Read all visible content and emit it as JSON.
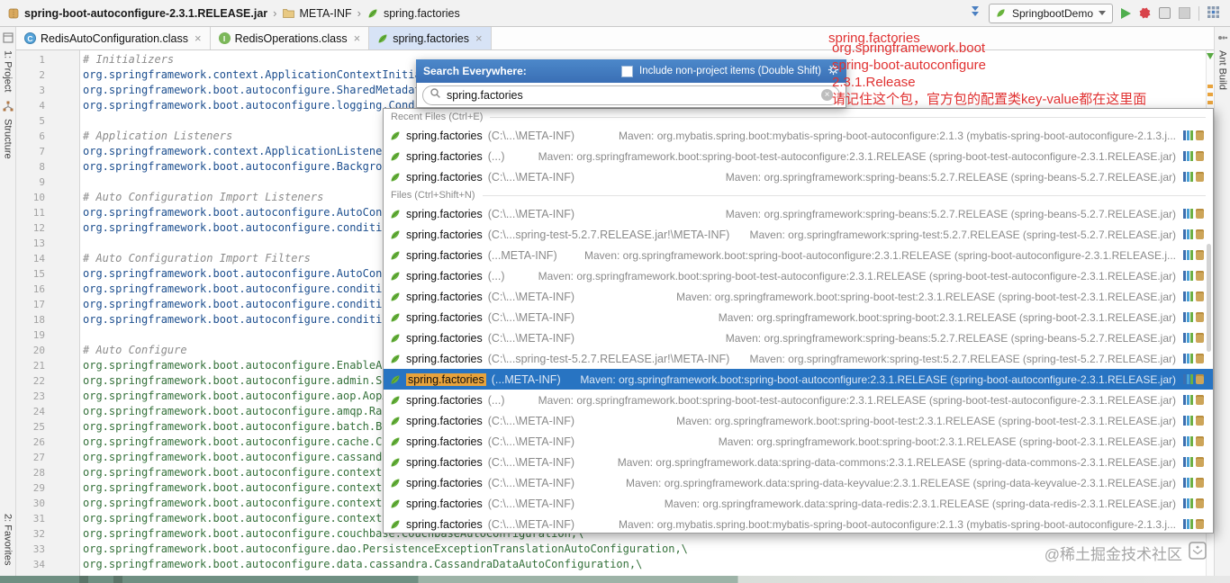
{
  "title_bar": {
    "breadcrumb": {
      "jar": "spring-boot-autoconfigure-2.3.1.RELEASE.jar",
      "dir": "META-INF",
      "file": "spring.factories"
    },
    "run_config": "SpringbootDemo"
  },
  "tabs": [
    {
      "label": "RedisAutoConfiguration.class"
    },
    {
      "label": "RedisOperations.class"
    },
    {
      "label": "spring.factories"
    }
  ],
  "tool_windows": {
    "project": "1: Project",
    "structure": "Structure",
    "favorites": "2: Favorites",
    "ant": "Ant Build"
  },
  "editor": {
    "lines": [
      {
        "n": 1,
        "cls": "comment",
        "text": "# Initializers"
      },
      {
        "n": 2,
        "cls": "ka",
        "text": "org.springframework.context.ApplicationContextInitializer=\\"
      },
      {
        "n": 3,
        "cls": "ka",
        "text": "org.springframework.boot.autoconfigure.SharedMetadataReaderFactoryContextInitializer,\\"
      },
      {
        "n": 4,
        "cls": "ka",
        "text": "org.springframework.boot.autoconfigure.logging.ConditionEvaluationReportLoggingListener"
      },
      {
        "n": 5,
        "cls": "ka",
        "text": ""
      },
      {
        "n": 6,
        "cls": "comment",
        "text": "# Application Listeners"
      },
      {
        "n": 7,
        "cls": "ka",
        "text": "org.springframework.context.ApplicationListener=\\"
      },
      {
        "n": 8,
        "cls": "ka",
        "text": "org.springframework.boot.autoconfigure.BackgroundPreinitializer"
      },
      {
        "n": 9,
        "cls": "ka",
        "text": ""
      },
      {
        "n": 10,
        "cls": "comment",
        "text": "# Auto Configuration Import Listeners"
      },
      {
        "n": 11,
        "cls": "ka",
        "text": "org.springframework.boot.autoconfigure.AutoConfigurationImportListener=\\"
      },
      {
        "n": 12,
        "cls": "ka",
        "text": "org.springframework.boot.autoconfigure.condition.ConditionEvaluationReportAutoConfigurationImportListener"
      },
      {
        "n": 13,
        "cls": "ka",
        "text": ""
      },
      {
        "n": 14,
        "cls": "comment",
        "text": "# Auto Configuration Import Filters"
      },
      {
        "n": 15,
        "cls": "ka",
        "text": "org.springframework.boot.autoconfigure.AutoConfigurationImportFilter=\\"
      },
      {
        "n": 16,
        "cls": "ka",
        "text": "org.springframework.boot.autoconfigure.condition.OnBeanCondition,\\"
      },
      {
        "n": 17,
        "cls": "ka",
        "text": "org.springframework.boot.autoconfigure.condition.OnClassCondition,\\"
      },
      {
        "n": 18,
        "cls": "ka",
        "text": "org.springframework.boot.autoconfigure.condition.OnWebApplicationCondition"
      },
      {
        "n": 19,
        "cls": "ka",
        "text": ""
      },
      {
        "n": 20,
        "cls": "comment",
        "text": "# Auto Configure"
      },
      {
        "n": 21,
        "cls": "kb",
        "text": "org.springframework.boot.autoconfigure.EnableAutoConfiguration=\\"
      },
      {
        "n": 22,
        "cls": "kb",
        "text": "org.springframework.boot.autoconfigure.admin.SpringApplicationAdminJmxAutoConfiguration,\\"
      },
      {
        "n": 23,
        "cls": "kb",
        "text": "org.springframework.boot.autoconfigure.aop.AopAutoConfiguration,\\"
      },
      {
        "n": 24,
        "cls": "kb",
        "text": "org.springframework.boot.autoconfigure.amqp.RabbitAutoConfiguration,\\"
      },
      {
        "n": 25,
        "cls": "kb",
        "text": "org.springframework.boot.autoconfigure.batch.BatchAutoConfiguration,\\"
      },
      {
        "n": 26,
        "cls": "kb",
        "text": "org.springframework.boot.autoconfigure.cache.CacheAutoConfiguration,\\"
      },
      {
        "n": 27,
        "cls": "kb",
        "text": "org.springframework.boot.autoconfigure.cassandra.CassandraAutoConfiguration,\\"
      },
      {
        "n": 28,
        "cls": "kb",
        "text": "org.springframework.boot.autoconfigure.context.ConfigurationPropertiesAutoConfiguration,\\"
      },
      {
        "n": 29,
        "cls": "kb",
        "text": "org.springframework.boot.autoconfigure.context.LifecycleAutoConfiguration,\\"
      },
      {
        "n": 30,
        "cls": "kb",
        "text": "org.springframework.boot.autoconfigure.context.MessageSourceAutoConfiguration,\\"
      },
      {
        "n": 31,
        "cls": "kb",
        "text": "org.springframework.boot.autoconfigure.context.PropertyPlaceholderAutoConfiguration,\\"
      },
      {
        "n": 32,
        "cls": "kb",
        "text": "org.springframework.boot.autoconfigure.couchbase.CouchbaseAutoConfiguration,\\"
      },
      {
        "n": 33,
        "cls": "kb",
        "text": "org.springframework.boot.autoconfigure.dao.PersistenceExceptionTranslationAutoConfiguration,\\"
      },
      {
        "n": 34,
        "cls": "kb",
        "text": "org.springframework.boot.autoconfigure.data.cassandra.CassandraDataAutoConfiguration,\\"
      }
    ]
  },
  "popup": {
    "title": "Search Everywhere:",
    "include_label": "Include non-project items (Double Shift)",
    "search_value": "spring.factories",
    "recent_header": "Recent Files (Ctrl+E)",
    "files_header": "Files (Ctrl+Shift+N)",
    "recent_rows": [
      {
        "name": "spring.factories",
        "path": "(C:\\...\\META-INF)",
        "detail": "Maven: org.mybatis.spring.boot:mybatis-spring-boot-autoconfigure:2.1.3 (mybatis-spring-boot-autoconfigure-2.1.3.j..."
      },
      {
        "name": "spring.factories",
        "path": "(...)",
        "detail": "Maven: org.springframework.boot:spring-boot-test-autoconfigure:2.3.1.RELEASE (spring-boot-test-autoconfigure-2.3.1.RELEASE.jar)"
      },
      {
        "name": "spring.factories",
        "path": "(C:\\...\\META-INF)",
        "detail": "Maven: org.springframework:spring-beans:5.2.7.RELEASE (spring-beans-5.2.7.RELEASE.jar)"
      }
    ],
    "file_rows": [
      {
        "name": "spring.factories",
        "path": "(C:\\...\\META-INF)",
        "detail": "Maven: org.springframework:spring-beans:5.2.7.RELEASE (spring-beans-5.2.7.RELEASE.jar)"
      },
      {
        "name": "spring.factories",
        "path": "(C:\\...spring-test-5.2.7.RELEASE.jar!\\META-INF)",
        "detail": "Maven: org.springframework:spring-test:5.2.7.RELEASE (spring-test-5.2.7.RELEASE.jar)"
      },
      {
        "name": "spring.factories",
        "path": "(...META-INF)",
        "detail": "Maven: org.springframework.boot:spring-boot-autoconfigure:2.3.1.RELEASE (spring-boot-autoconfigure-2.3.1.RELEASE.j..."
      },
      {
        "name": "spring.factories",
        "path": "(...)",
        "detail": "Maven: org.springframework.boot:spring-boot-test-autoconfigure:2.3.1.RELEASE (spring-boot-test-autoconfigure-2.3.1.RELEASE.jar)"
      },
      {
        "name": "spring.factories",
        "path": "(C:\\...\\META-INF)",
        "detail": "Maven: org.springframework.boot:spring-boot-test:2.3.1.RELEASE (spring-boot-test-2.3.1.RELEASE.jar)"
      },
      {
        "name": "spring.factories",
        "path": "(C:\\...\\META-INF)",
        "detail": "Maven: org.springframework.boot:spring-boot:2.3.1.RELEASE (spring-boot-2.3.1.RELEASE.jar)"
      },
      {
        "name": "spring.factories",
        "path": "(C:\\...\\META-INF)",
        "detail": "Maven: org.springframework:spring-beans:5.2.7.RELEASE (spring-beans-5.2.7.RELEASE.jar)"
      },
      {
        "name": "spring.factories",
        "path": "(C:\\...spring-test-5.2.7.RELEASE.jar!\\META-INF)",
        "detail": "Maven: org.springframework:spring-test:5.2.7.RELEASE (spring-test-5.2.7.RELEASE.jar)"
      },
      {
        "name": "spring.factories",
        "path": "(...META-INF)",
        "detail": "Maven: org.springframework.boot:spring-boot-autoconfigure:2.3.1.RELEASE (spring-boot-autoconfigure-2.3.1.RELEASE.jar)",
        "cls": "selected"
      },
      {
        "name": "spring.factories",
        "path": "(...)",
        "detail": "Maven: org.springframework.boot:spring-boot-test-autoconfigure:2.3.1.RELEASE (spring-boot-test-autoconfigure-2.3.1.RELEASE.jar)"
      },
      {
        "name": "spring.factories",
        "path": "(C:\\...\\META-INF)",
        "detail": "Maven: org.springframework.boot:spring-boot-test:2.3.1.RELEASE (spring-boot-test-2.3.1.RELEASE.jar)"
      },
      {
        "name": "spring.factories",
        "path": "(C:\\...\\META-INF)",
        "detail": "Maven: org.springframework.boot:spring-boot:2.3.1.RELEASE (spring-boot-2.3.1.RELEASE.jar)"
      },
      {
        "name": "spring.factories",
        "path": "(C:\\...\\META-INF)",
        "detail": "Maven: org.springframework.data:spring-data-commons:2.3.1.RELEASE (spring-data-commons-2.3.1.RELEASE.jar)"
      },
      {
        "name": "spring.factories",
        "path": "(C:\\...\\META-INF)",
        "detail": "Maven: org.springframework.data:spring-data-keyvalue:2.3.1.RELEASE (spring-data-keyvalue-2.3.1.RELEASE.jar)"
      },
      {
        "name": "spring.factories",
        "path": "(C:\\...\\META-INF)",
        "detail": "Maven: org.springframework.data:spring-data-redis:2.3.1.RELEASE (spring-data-redis-2.3.1.RELEASE.jar)"
      },
      {
        "name": "spring.factories",
        "path": "(C:\\...\\META-INF)",
        "detail": "Maven: org.mybatis.spring.boot:mybatis-spring-boot-autoconfigure:2.1.3 (mybatis-spring-boot-autoconfigure-2.1.3.j..."
      }
    ]
  },
  "annotations": {
    "tab_note": "spring.factories",
    "lines": [
      "org.springframework.boot",
      "spring-boot-autoconfigure",
      "2.3.1.Release",
      "请记住这个包，官方包的配置类key-value都在这里面"
    ]
  },
  "watermark": {
    "text": "@稀土掘金技术社区"
  }
}
